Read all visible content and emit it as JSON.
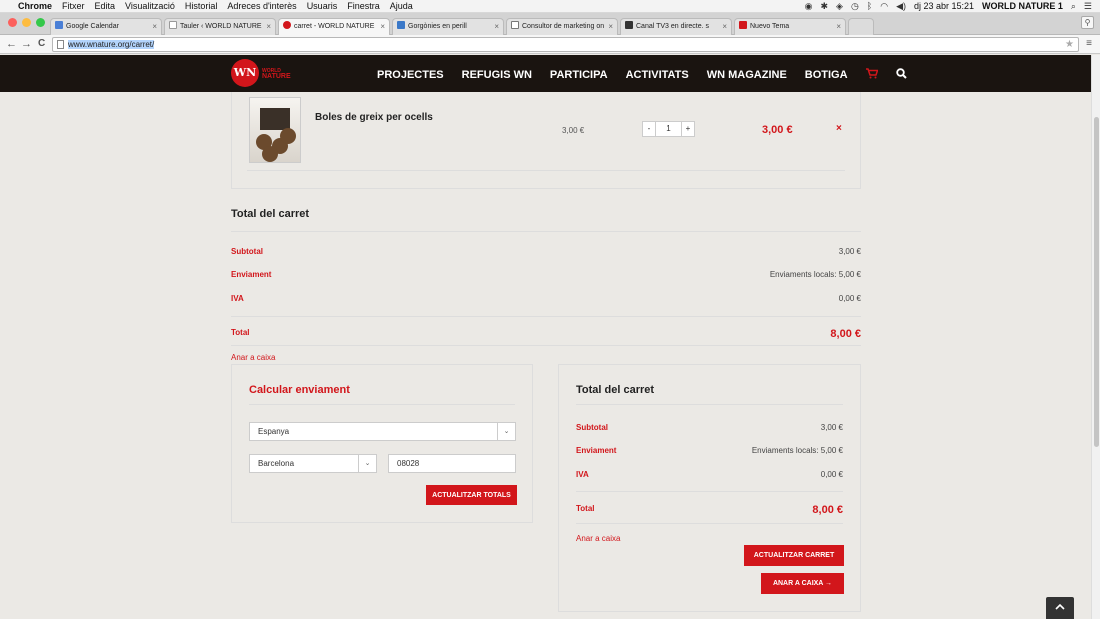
{
  "menubar": {
    "apple": "",
    "items": [
      "Chrome",
      "Fitxer",
      "Edita",
      "Visualització",
      "Historial",
      "Adreces d'interès",
      "Usuaris",
      "Finestra",
      "Ajuda"
    ],
    "datetime": "dj 23 abr  15:21",
    "user": "WORLD NATURE 1"
  },
  "tabs": [
    {
      "title": "Google Calendar",
      "color": "#4a7fd6"
    },
    {
      "title": "Tauler ‹ WORLD NATURE",
      "color": "#9a9a9a"
    },
    {
      "title": "carret - WORLD NATURE",
      "color": "#d2161b"
    },
    {
      "title": "Gorgònies en perill",
      "color": "#3a78c8"
    },
    {
      "title": "Consultor de marketing on",
      "color": "#777777"
    },
    {
      "title": "Canal TV3 en directe. s",
      "color": "#333333"
    },
    {
      "title": "Nuevo Tema",
      "color": "#d2161b"
    }
  ],
  "toolbar": {
    "back": "←",
    "forward": "→",
    "reload": "C",
    "url": "www.wnature.org/carret/"
  },
  "site": {
    "logo": "WN",
    "logo_small": "WORLD",
    "logo_big": "NATURE",
    "nav": [
      "PROJECTES",
      "REFUGIS WN",
      "PARTICIPA",
      "ACTIVITATS",
      "WN MAGAZINE",
      "BOTIGA"
    ]
  },
  "cart_item": {
    "name": "Boles de greix per ocells",
    "unit_price": "3,00 €",
    "qty_minus": "-",
    "qty": "1",
    "qty_plus": "+",
    "line_total": "3,00 €",
    "remove": "×"
  },
  "totals_top": {
    "title": "Total del carret",
    "subtotal_label": "Subtotal",
    "subtotal_value": "3,00 €",
    "shipping_label": "Enviament",
    "shipping_value": "Enviaments locals: 5,00 €",
    "vat_label": "IVA",
    "vat_value": "0,00 €",
    "total_label": "Total",
    "total_value": "8,00 €",
    "checkout_link": "Anar a caixa"
  },
  "shipping_calc": {
    "title": "Calcular enviament",
    "country": "Espanya",
    "province": "Barcelona",
    "postcode": "08028",
    "update_button": "ACTUALITZAR TOTALS"
  },
  "totals_box": {
    "title": "Total del carret",
    "subtotal_label": "Subtotal",
    "subtotal_value": "3,00 €",
    "shipping_label": "Enviament",
    "shipping_value": "Enviaments locals: 5,00 €",
    "vat_label": "IVA",
    "vat_value": "0,00 €",
    "total_label": "Total",
    "total_value": "8,00 €",
    "checkout_link": "Anar a caixa",
    "update_cart_button": "ACTUALITZAR CARRET",
    "checkout_button": "ANAR A CAIXA →"
  },
  "colors": {
    "brand_red": "#d2161b",
    "header_bg": "#1a1410",
    "page_bg": "#ebe9e5"
  }
}
